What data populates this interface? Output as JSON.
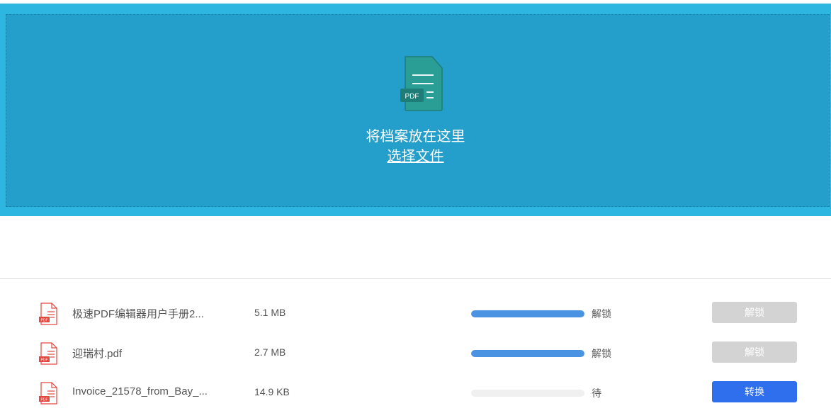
{
  "dropzone": {
    "icon_label": "PDF",
    "title": "将档案放在这里",
    "select_label": "选择文件"
  },
  "files": [
    {
      "name": "极速PDF编辑器用户手册2...",
      "size": "5.1 MB",
      "progress": 1.0,
      "status": "解锁",
      "action": "解锁",
      "action_enabled": false
    },
    {
      "name": "迎瑞村.pdf",
      "size": "2.7 MB",
      "progress": 1.0,
      "status": "解锁",
      "action": "解锁",
      "action_enabled": false
    },
    {
      "name": "Invoice_21578_from_Bay_...",
      "size": "14.9 KB",
      "progress": 0.0,
      "status": "待",
      "action": "转换",
      "action_enabled": true
    }
  ],
  "colors": {
    "dropzone_outer": "#2cb6e0",
    "dropzone_inner": "#249fcb",
    "progress_fill": "#4a93e3",
    "button_primary": "#2f6fee",
    "button_disabled": "#d3d3d3"
  }
}
